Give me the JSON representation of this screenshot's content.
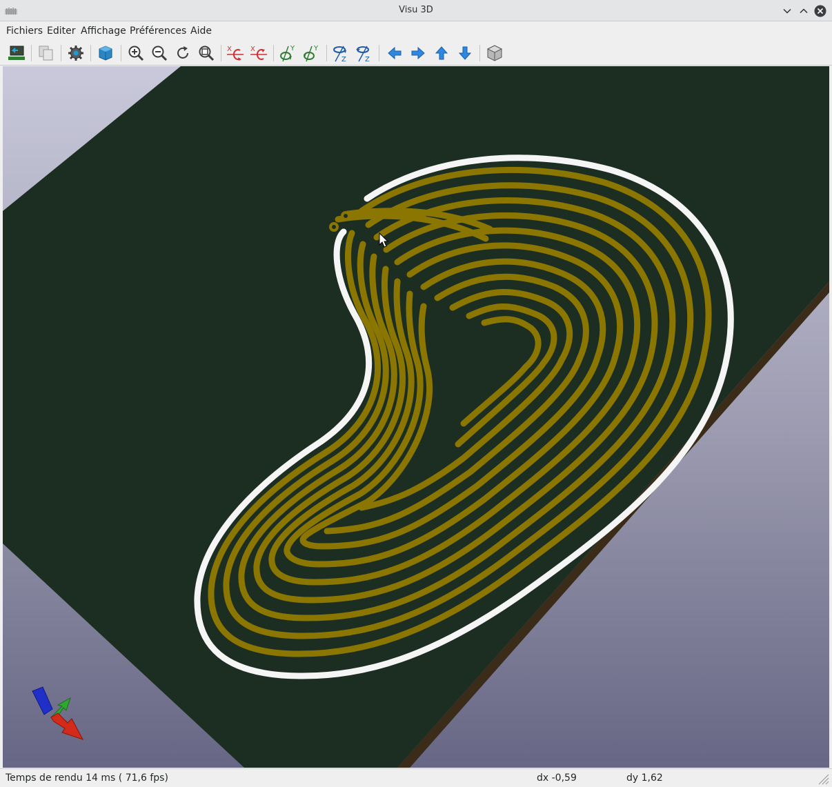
{
  "window": {
    "title": "Visu 3D"
  },
  "menu": [
    "Fichiers",
    "Editer",
    "Affichage",
    "Préférences",
    "Aide"
  ],
  "toolbar": [
    "reload-board",
    "copy-image",
    "settings",
    "render-realistic",
    "zoom-in",
    "zoom-out",
    "redraw",
    "zoom-fit",
    "rotate-x-cw",
    "rotate-x-ccw",
    "rotate-y-cw",
    "rotate-y-ccw",
    "rotate-z-cw",
    "rotate-z-ccw",
    "move-left",
    "move-right",
    "move-up",
    "move-down",
    "toggle-ortho"
  ],
  "scene": {
    "board_color": "#1c2e22",
    "board_edge_color": "#3a2c18",
    "background_color": "#9796a9",
    "track_color": "#8a7600",
    "outline_color": "#f5f5f5"
  },
  "status": {
    "render_time": "Temps de rendu 14 ms ( 71,6 fps)",
    "dx": "dx -0,59",
    "dy": "dy 1,62"
  }
}
